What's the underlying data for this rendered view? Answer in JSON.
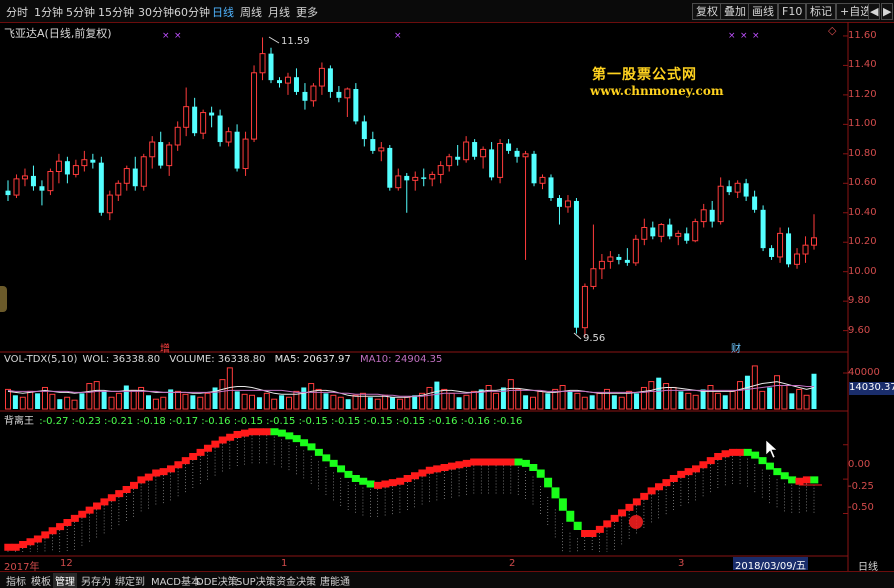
{
  "toolbar": {
    "periods": [
      "分时",
      "1分钟",
      "5分钟",
      "15分钟",
      "30分钟",
      "60分钟",
      "日线",
      "周线",
      "月线",
      "更多"
    ],
    "active_period": "日线",
    "right_buttons": [
      "复权",
      "叠加",
      "画线",
      "F10",
      "标记",
      "+自选",
      "◀",
      "▶"
    ]
  },
  "price_panel": {
    "title": "飞亚达A(日线,前复权)",
    "high_label": "11.59",
    "low_label": "9.56",
    "event_labels": [
      "增",
      "财"
    ],
    "y_ticks": [
      "11.60",
      "11.40",
      "11.20",
      "11.00",
      "10.80",
      "10.60",
      "10.40",
      "10.20",
      "10.00",
      "9.80",
      "9.60"
    ],
    "watermark_title": "第一股票公式网",
    "watermark_url": "www.chnmoney.com"
  },
  "volume_panel": {
    "name": "VOL-TDX(5,10)",
    "wol_label": "WOL: 36338.80",
    "volume_label": "VOLUME: 36338.80",
    "ma5_label": "MA5: 20637.97",
    "ma10_label": "MA10: 24904.35",
    "y_ticks": [
      "40000",
      "20000"
    ],
    "current_value": "14030.37"
  },
  "indicator_panel": {
    "name": "背离王",
    "values": ":-0.27 :-0.23 :-0.21 :-0.18 :-0.17 :-0.16 :-0.15 :-0.15 :-0.15 :-0.15 :-0.15 :-0.15 :-0.16 :-0.16 :-0.16",
    "y_ticks": [
      "0.00",
      "-0.25",
      "-0.50"
    ]
  },
  "date_axis": {
    "labels": [
      "2017年",
      "12",
      "1",
      "2",
      "3"
    ],
    "cursor_date": "2018/03/09/五",
    "right_label": "日线"
  },
  "bottom_tabs": [
    "指标",
    "模板",
    "管理",
    "另存为",
    "绑定到",
    "MACD基本",
    "DDE决策",
    "SUP决策",
    "资金决策",
    "唐能通"
  ],
  "bottom_active_tab": "管理",
  "colors": {
    "up": "#ff3c3c",
    "down": "#54ffff",
    "grid_red": "#8a1414",
    "indicator_up": "#ff1a1a",
    "indicator_down": "#1aff1a",
    "ma10": "#c070c0",
    "watermark": "#ffd21f"
  },
  "chart_data": [
    {
      "type": "candlestick",
      "title": "飞亚达A(日线,前复权)",
      "ylim": [
        9.5,
        11.7
      ],
      "candles": [
        [
          10.55,
          10.62,
          10.48,
          10.52
        ],
        [
          10.52,
          10.66,
          10.5,
          10.63
        ],
        [
          10.63,
          10.7,
          10.58,
          10.65
        ],
        [
          10.65,
          10.72,
          10.55,
          10.58
        ],
        [
          10.58,
          10.62,
          10.45,
          10.55
        ],
        [
          10.55,
          10.7,
          10.52,
          10.68
        ],
        [
          10.68,
          10.8,
          10.6,
          10.75
        ],
        [
          10.75,
          10.78,
          10.6,
          10.66
        ],
        [
          10.66,
          10.76,
          10.64,
          10.72
        ],
        [
          10.72,
          10.82,
          10.68,
          10.76
        ],
        [
          10.76,
          10.8,
          10.7,
          10.74
        ],
        [
          10.74,
          10.78,
          10.38,
          10.4
        ],
        [
          10.4,
          10.55,
          10.35,
          10.52
        ],
        [
          10.52,
          10.62,
          10.48,
          10.6
        ],
        [
          10.6,
          10.72,
          10.55,
          10.7
        ],
        [
          10.7,
          10.78,
          10.55,
          10.58
        ],
        [
          10.58,
          10.8,
          10.55,
          10.78
        ],
        [
          10.78,
          10.92,
          10.7,
          10.88
        ],
        [
          10.88,
          10.95,
          10.7,
          10.72
        ],
        [
          10.72,
          10.88,
          10.65,
          10.86
        ],
        [
          10.86,
          11.02,
          10.82,
          10.98
        ],
        [
          10.98,
          11.25,
          10.92,
          11.12
        ],
        [
          11.12,
          11.18,
          10.92,
          10.94
        ],
        [
          10.94,
          11.1,
          10.9,
          11.08
        ],
        [
          11.08,
          11.12,
          10.98,
          11.06
        ],
        [
          11.06,
          11.1,
          10.85,
          10.88
        ],
        [
          10.88,
          10.98,
          10.85,
          10.95
        ],
        [
          10.95,
          11.0,
          10.68,
          10.7
        ],
        [
          10.7,
          10.95,
          10.65,
          10.9
        ],
        [
          10.9,
          11.4,
          10.88,
          11.35
        ],
        [
          11.35,
          11.59,
          11.3,
          11.48
        ],
        [
          11.48,
          11.52,
          11.28,
          11.3
        ],
        [
          11.3,
          11.32,
          11.25,
          11.28
        ],
        [
          11.28,
          11.35,
          11.2,
          11.32
        ],
        [
          11.32,
          11.38,
          11.2,
          11.22
        ],
        [
          11.22,
          11.28,
          11.1,
          11.16
        ],
        [
          11.16,
          11.28,
          11.12,
          11.26
        ],
        [
          11.26,
          11.42,
          11.2,
          11.38
        ],
        [
          11.38,
          11.4,
          11.18,
          11.22
        ],
        [
          11.22,
          11.26,
          11.15,
          11.18
        ],
        [
          11.18,
          11.25,
          11.05,
          11.24
        ],
        [
          11.24,
          11.28,
          11.0,
          11.02
        ],
        [
          11.02,
          11.06,
          10.85,
          10.9
        ],
        [
          10.9,
          10.95,
          10.8,
          10.82
        ],
        [
          10.82,
          10.88,
          10.75,
          10.84
        ],
        [
          10.84,
          10.86,
          10.55,
          10.57
        ],
        [
          10.57,
          10.7,
          10.55,
          10.65
        ],
        [
          10.65,
          10.67,
          10.4,
          10.62
        ],
        [
          10.62,
          10.68,
          10.55,
          10.64
        ],
        [
          10.64,
          10.7,
          10.58,
          10.63
        ],
        [
          10.63,
          10.68,
          10.58,
          10.66
        ],
        [
          10.66,
          10.75,
          10.6,
          10.72
        ],
        [
          10.72,
          10.8,
          10.68,
          10.78
        ],
        [
          10.78,
          10.86,
          10.72,
          10.76
        ],
        [
          10.76,
          10.92,
          10.74,
          10.88
        ],
        [
          10.88,
          10.9,
          10.76,
          10.78
        ],
        [
          10.78,
          10.85,
          10.7,
          10.83
        ],
        [
          10.83,
          10.88,
          10.62,
          10.64
        ],
        [
          10.64,
          10.9,
          10.6,
          10.87
        ],
        [
          10.87,
          10.9,
          10.8,
          10.82
        ],
        [
          10.82,
          10.84,
          10.74,
          10.78
        ],
        [
          10.78,
          10.82,
          10.08,
          10.8
        ],
        [
          10.8,
          10.82,
          10.58,
          10.6
        ],
        [
          10.6,
          10.66,
          10.56,
          10.64
        ],
        [
          10.64,
          10.66,
          10.48,
          10.5
        ],
        [
          10.5,
          10.52,
          10.32,
          10.44
        ],
        [
          10.44,
          10.52,
          10.4,
          10.48
        ],
        [
          10.48,
          10.5,
          9.58,
          9.62
        ],
        [
          9.62,
          9.92,
          9.56,
          9.9
        ],
        [
          9.9,
          10.32,
          9.88,
          10.02
        ],
        [
          10.02,
          10.12,
          9.95,
          10.07
        ],
        [
          10.07,
          10.14,
          10.02,
          10.1
        ],
        [
          10.1,
          10.12,
          10.05,
          10.08
        ],
        [
          10.08,
          10.16,
          10.04,
          10.06
        ],
        [
          10.06,
          10.25,
          10.04,
          10.22
        ],
        [
          10.22,
          10.36,
          10.18,
          10.3
        ],
        [
          10.3,
          10.34,
          10.22,
          10.24
        ],
        [
          10.24,
          10.33,
          10.2,
          10.32
        ],
        [
          10.32,
          10.36,
          10.22,
          10.24
        ],
        [
          10.24,
          10.28,
          10.18,
          10.26
        ],
        [
          10.26,
          10.3,
          10.19,
          10.21
        ],
        [
          10.21,
          10.36,
          10.2,
          10.34
        ],
        [
          10.34,
          10.46,
          10.3,
          10.42
        ],
        [
          10.42,
          10.48,
          10.3,
          10.34
        ],
        [
          10.34,
          10.64,
          10.32,
          10.58
        ],
        [
          10.58,
          10.62,
          10.52,
          10.54
        ],
        [
          10.54,
          10.62,
          10.5,
          10.6
        ],
        [
          10.6,
          10.63,
          10.48,
          10.51
        ],
        [
          10.51,
          10.55,
          10.4,
          10.42
        ],
        [
          10.42,
          10.45,
          10.14,
          10.16
        ],
        [
          10.16,
          10.18,
          10.08,
          10.1
        ],
        [
          10.1,
          10.3,
          10.06,
          10.26
        ],
        [
          10.26,
          10.3,
          10.03,
          10.05
        ],
        [
          10.05,
          10.16,
          10.02,
          10.12
        ],
        [
          10.12,
          10.24,
          10.06,
          10.18
        ],
        [
          10.18,
          10.39,
          10.15,
          10.23
        ]
      ]
    },
    {
      "type": "bar",
      "title": "VOL-TDX(5,10)",
      "ylim": [
        0,
        48000
      ],
      "values": [
        20,
        14,
        12,
        18,
        16,
        22,
        15,
        10,
        12,
        9,
        16,
        26,
        28,
        18,
        12,
        16,
        24,
        19,
        22,
        14,
        10,
        12,
        20,
        18,
        15,
        14,
        12,
        16,
        22,
        30,
        42,
        18,
        15,
        14,
        12,
        16,
        10,
        14,
        12,
        18,
        22,
        26,
        20,
        16,
        14,
        12,
        10,
        14,
        16,
        12,
        10,
        14,
        12,
        10,
        12,
        14,
        16,
        22,
        28,
        20,
        16,
        12,
        14,
        18,
        20,
        24,
        16,
        22,
        30,
        20,
        14,
        12,
        18,
        16,
        20,
        24,
        18,
        16,
        12,
        14,
        16,
        20,
        14,
        12,
        18,
        16,
        22,
        28,
        32,
        26,
        22,
        18,
        16,
        14,
        20,
        24,
        16,
        14,
        18,
        28,
        34,
        44,
        18,
        22,
        34,
        24,
        16,
        20,
        14,
        36
      ],
      "ma5": [
        18,
        17,
        16,
        17,
        18,
        19,
        18,
        17,
        17,
        16,
        17,
        18,
        19,
        19,
        18,
        18,
        19,
        19,
        19,
        18,
        17,
        17,
        17,
        17,
        17,
        16,
        16,
        17,
        18,
        20,
        22,
        23,
        23,
        22,
        20,
        18,
        16,
        15,
        15,
        15,
        16,
        18,
        19,
        19,
        18,
        16,
        14,
        13,
        13,
        13,
        13,
        13,
        12,
        12,
        12,
        13,
        14,
        16,
        18,
        19,
        19,
        18,
        17,
        17,
        18,
        19,
        19,
        20,
        21,
        21,
        20,
        19,
        18,
        17,
        17,
        18,
        19,
        19,
        18,
        17,
        16,
        16,
        16,
        16,
        16,
        17,
        18,
        19,
        21,
        22,
        22,
        21,
        20,
        19,
        18,
        18,
        18,
        18,
        18,
        20,
        22,
        24,
        26,
        27,
        28,
        26,
        24,
        22,
        20,
        22
      ],
      "ma10": [
        19,
        18,
        18,
        18,
        18,
        18,
        18,
        18,
        18,
        17,
        17,
        17,
        18,
        18,
        18,
        18,
        18,
        18,
        18,
        18,
        18,
        17,
        17,
        17,
        17,
        17,
        17,
        17,
        17,
        18,
        19,
        19,
        19,
        19,
        19,
        19,
        19,
        19,
        18,
        17,
        17,
        17,
        17,
        17,
        17,
        16,
        16,
        15,
        15,
        15,
        15,
        14,
        14,
        13,
        13,
        13,
        13,
        14,
        15,
        16,
        16,
        16,
        16,
        17,
        17,
        18,
        18,
        18,
        19,
        19,
        19,
        19,
        19,
        18,
        18,
        18,
        18,
        18,
        18,
        17,
        17,
        17,
        17,
        17,
        17,
        17,
        17,
        18,
        18,
        19,
        19,
        19,
        19,
        19,
        19,
        19,
        19,
        19,
        19,
        19,
        20,
        21,
        22,
        23,
        24,
        24,
        24,
        24,
        23,
        23
      ]
    },
    {
      "type": "line",
      "title": "背离王",
      "ylim": [
        -0.78,
        0.18
      ],
      "values": [
        -0.72,
        -0.72,
        -0.7,
        -0.68,
        -0.66,
        -0.63,
        -0.6,
        -0.57,
        -0.54,
        -0.51,
        -0.48,
        -0.45,
        -0.42,
        -0.39,
        -0.36,
        -0.33,
        -0.3,
        -0.27,
        -0.23,
        -0.21,
        -0.18,
        -0.17,
        -0.15,
        -0.12,
        -0.09,
        -0.06,
        -0.03,
        0.0,
        0.03,
        0.06,
        0.08,
        0.1,
        0.11,
        0.12,
        0.12,
        0.12,
        0.11,
        0.09,
        0.07,
        0.04,
        0.01,
        -0.03,
        -0.07,
        -0.11,
        -0.15,
        -0.19,
        -0.22,
        -0.24,
        -0.26,
        -0.27,
        -0.27,
        -0.26,
        -0.25,
        -0.24,
        -0.22,
        -0.2,
        -0.18,
        -0.16,
        -0.15,
        -0.14,
        -0.13,
        -0.12,
        -0.11,
        -0.1,
        -0.1,
        -0.1,
        -0.1,
        -0.1,
        -0.1,
        -0.11,
        -0.14,
        -0.18,
        -0.24,
        -0.31,
        -0.39,
        -0.48,
        -0.56,
        -0.62,
        -0.62,
        -0.62,
        -0.59,
        -0.55,
        -0.51,
        -0.47,
        -0.43,
        -0.39,
        -0.35,
        -0.31,
        -0.28,
        -0.25,
        -0.22,
        -0.19,
        -0.17,
        -0.15,
        -0.12,
        -0.09,
        -0.06,
        -0.04,
        -0.03,
        -0.03,
        -0.05,
        -0.09,
        -0.13,
        -0.17,
        -0.2,
        -0.23,
        -0.24,
        -0.24,
        -0.23,
        -0.24
      ]
    }
  ]
}
